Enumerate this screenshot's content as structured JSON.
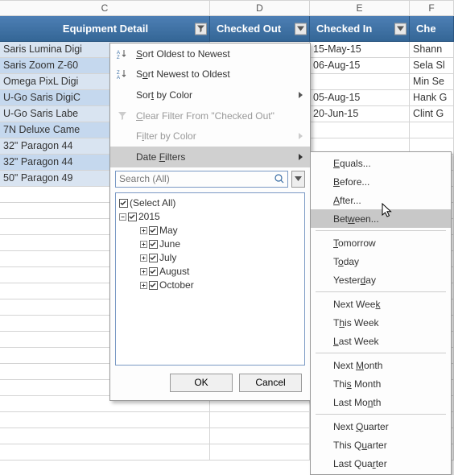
{
  "columns": {
    "C": "C",
    "D": "D",
    "E": "E",
    "F": "F"
  },
  "headers": {
    "c": "Equipment Detail",
    "d": "Checked Out",
    "e": "Checked In",
    "f": "Che"
  },
  "rows": [
    {
      "c": "Saris Lumina Digi",
      "e": "15-May-15",
      "f": "Shann"
    },
    {
      "c": "Saris Zoom Z-60",
      "e": "06-Aug-15",
      "f": "Sela Sl"
    },
    {
      "c": "Omega PixL Digi",
      "e": "",
      "f": "Min Se"
    },
    {
      "c": "U-Go Saris DigiC",
      "e": "05-Aug-15",
      "f": "Hank G"
    },
    {
      "c": "U-Go Saris Labe",
      "e": "20-Jun-15",
      "f": "Clint G"
    },
    {
      "c": "7N Deluxe Came",
      "e": "",
      "f": ""
    },
    {
      "c": "32\" Paragon 44",
      "e": "",
      "f": ""
    },
    {
      "c": "32\" Paragon 44",
      "e": "",
      "f": ""
    },
    {
      "c": "50\" Paragon 49",
      "e": "",
      "f": ""
    }
  ],
  "menu": {
    "sort_oldest": "Sort Oldest to Newest",
    "sort_newest": "Sort Newest to Oldest",
    "sort_color": "Sort by Color",
    "clear_filter": "Clear Filter From \"Checked Out\"",
    "filter_color": "Filter by Color",
    "date_filters": "Date Filters",
    "search_placeholder": "Search (All)",
    "select_all": "(Select All)",
    "year": "2015",
    "months": [
      "May",
      "June",
      "July",
      "August",
      "October"
    ],
    "ok": "OK",
    "cancel": "Cancel"
  },
  "submenu": {
    "equals": "Equals...",
    "before": "Before...",
    "after": "After...",
    "between": "Between...",
    "tomorrow": "Tomorrow",
    "today": "Today",
    "yesterday": "Yesterday",
    "next_week": "Next Week",
    "this_week": "This Week",
    "last_week": "Last Week",
    "next_month": "Next Month",
    "this_month": "This Month",
    "last_month": "Last Month",
    "next_quarter": "Next Quarter",
    "this_quarter": "This Quarter",
    "last_quarter": "Last Quarter"
  }
}
